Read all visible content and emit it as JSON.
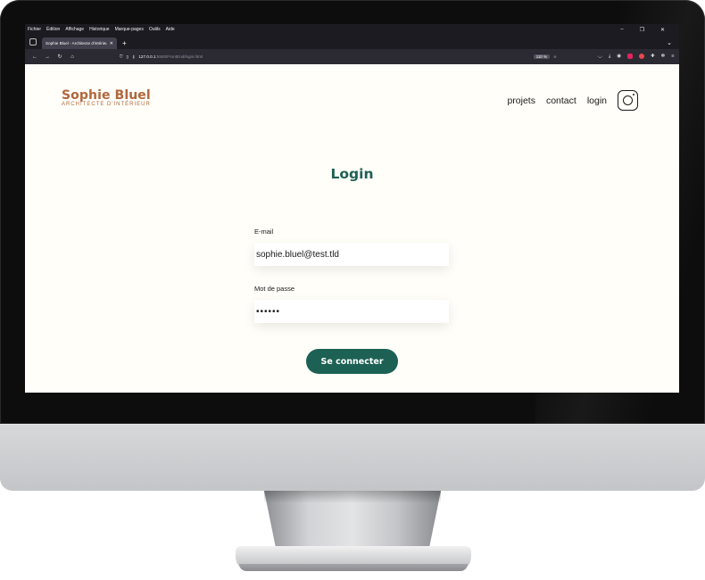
{
  "browser": {
    "menu": [
      "Fichier",
      "Édition",
      "Affichage",
      "Historique",
      "Marque-pages",
      "Outils",
      "Aide"
    ],
    "window_controls": [
      "–",
      "❐",
      "✕"
    ],
    "tab_title": "Sophie Bluel - Architecte d'intérieur",
    "tab_close": "✕",
    "new_tab": "+",
    "tab_list": "⌄",
    "nav": {
      "back": "←",
      "forward": "→",
      "reload": "↻",
      "home": "⌂"
    },
    "url_host": "127.0.0.1",
    "url_path": ":5500/FrontEnd/login.html",
    "zoom": "110 %",
    "bookmark_star": "☆",
    "menu_icon": "≡"
  },
  "site": {
    "logo_name": "Sophie Bluel",
    "logo_subtitle": "ARCHITECTE D'INTÉRIEUR",
    "nav": {
      "projects": "projets",
      "contact": "contact",
      "login": "login"
    }
  },
  "login": {
    "title": "Login",
    "email_label": "E-mail",
    "email_value": "sophie.bluel@test.tld",
    "password_label": "Mot de passe",
    "password_value": "••••••",
    "submit_label": "Se connecter"
  },
  "colors": {
    "brand_logo": "#b1663c",
    "primary_green": "#1d6154",
    "page_background": "#fffef8"
  }
}
